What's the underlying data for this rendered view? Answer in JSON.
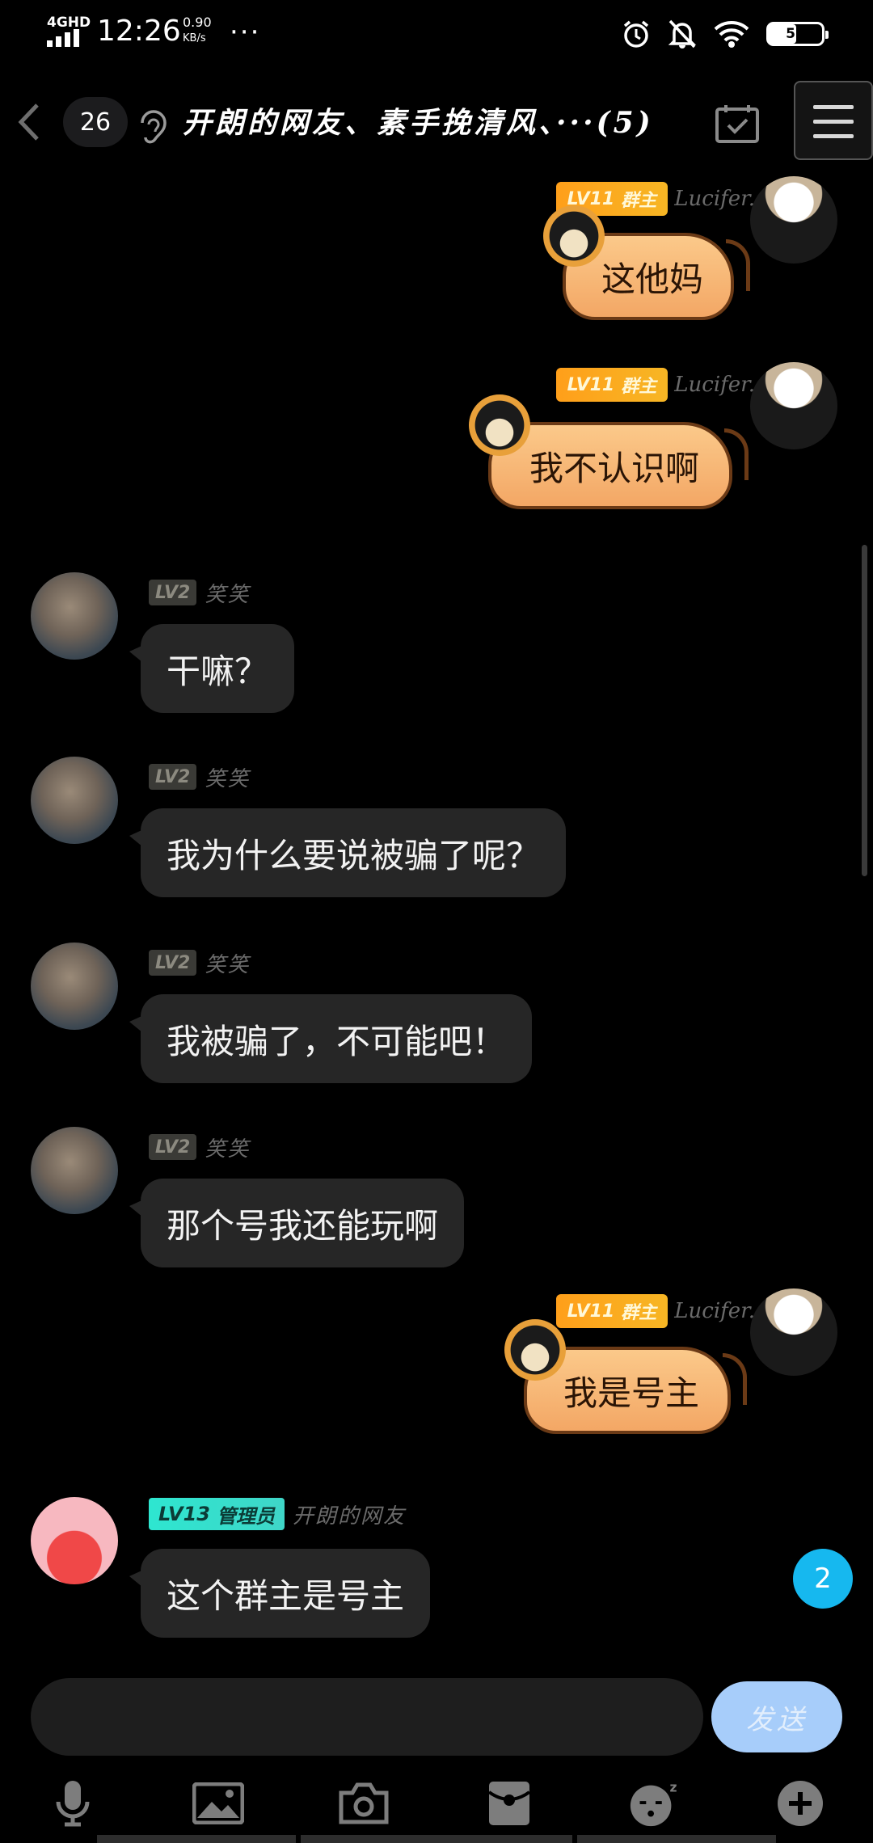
{
  "status_bar": {
    "network": "4GHD",
    "time": "12:26",
    "speed_value": "0.90",
    "speed_unit": "KB/s",
    "more": "···",
    "battery": "51"
  },
  "header": {
    "unread_count": "26",
    "title": "开朗的网友、素手挽清风、···(5)"
  },
  "messages": [
    {
      "side": "right",
      "level": "LV11",
      "role": "群主",
      "nick": "Lucifer.",
      "text": "这他妈",
      "style": "tiger"
    },
    {
      "side": "right",
      "level": "LV11",
      "role": "群主",
      "nick": "Lucifer.",
      "text": "我不认识啊",
      "style": "tiger"
    },
    {
      "side": "left",
      "level": "LV2",
      "nick": "笑笑",
      "text": "干嘛？"
    },
    {
      "side": "left",
      "level": "LV2",
      "nick": "笑笑",
      "text": "我为什么要说被骗了呢？"
    },
    {
      "side": "left",
      "level": "LV2",
      "nick": "笑笑",
      "text": "我被骗了，不可能吧！"
    },
    {
      "side": "left",
      "level": "LV2",
      "nick": "笑笑",
      "text": "那个号我还能玩啊"
    },
    {
      "side": "right",
      "level": "LV11",
      "role": "群主",
      "nick": "Lucifer.",
      "text": "我是号主",
      "style": "tiger"
    },
    {
      "side": "left",
      "level": "LV13",
      "role": "管理员",
      "nick": "开朗的网友",
      "text": "这个群主是号主"
    }
  ],
  "new_messages_badge": "2",
  "composer": {
    "placeholder": "",
    "send_label": "发送"
  },
  "toolbar": [
    "microphone-icon",
    "image-icon",
    "camera-icon",
    "red-packet-icon",
    "emoji-icon",
    "plus-icon"
  ],
  "colors": {
    "accent_send": "#a7cdfa",
    "badge": "#16b8ef",
    "owner_badge": "#ff9f1a",
    "admin_badge": "#2ee6d0"
  }
}
